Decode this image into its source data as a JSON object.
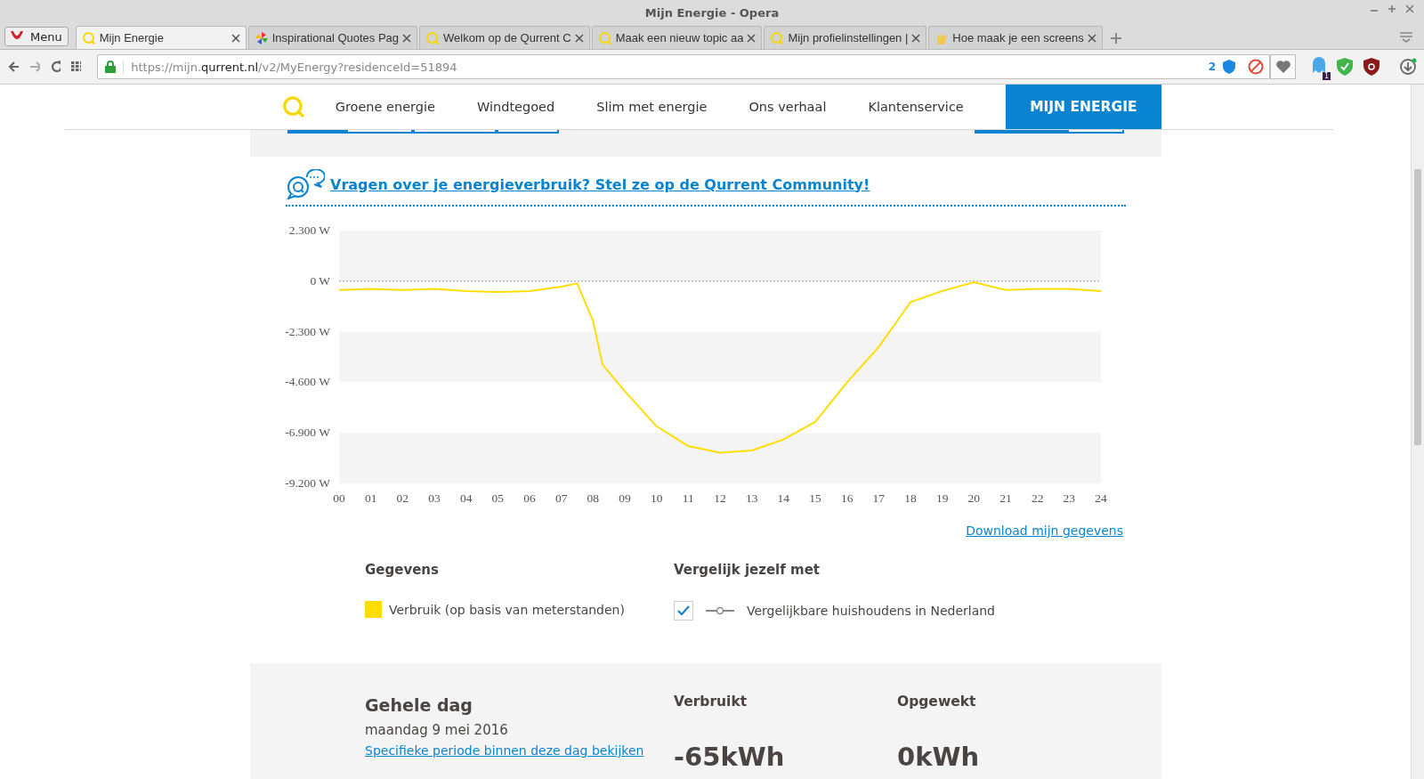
{
  "window": {
    "title": "Mijn Energie - Opera"
  },
  "browser": {
    "menu_label": "Menu",
    "tabs": [
      {
        "label": "Mijn Energie",
        "kind": "qurrent",
        "selected": true
      },
      {
        "label": "Inspirational Quotes Pag",
        "kind": "pinwheel",
        "selected": false
      },
      {
        "label": "Welkom op de Qurrent C",
        "kind": "qurrent",
        "selected": false
      },
      {
        "label": "Maak een nieuw topic aa",
        "kind": "qurrent",
        "selected": false
      },
      {
        "label": "Mijn profielinstellingen |",
        "kind": "qurrent",
        "selected": false
      },
      {
        "label": "Hoe maak je een screens",
        "kind": "hand",
        "selected": false
      }
    ],
    "url": {
      "prefix": "https://mijn.",
      "domain": "qurrent.nl",
      "path": "/v2/MyEnergy?residenceId=51894"
    },
    "shield_count": "2",
    "ghost_count": "1"
  },
  "nav": {
    "links": [
      "Groene energie",
      "Windtegoed",
      "Slim met energie",
      "Ons verhaal",
      "Klantenservice"
    ],
    "account_button": {
      "label": "MIJN ENERGIE",
      "selected": true
    }
  },
  "community_link": "Vragen over je energieverbruik? Stel ze op de Qurrent Community!",
  "chart": {
    "chart_data": {
      "type": "line",
      "x": [
        0,
        1,
        2,
        3,
        4,
        5,
        6,
        7,
        7.5,
        8,
        8.3,
        9,
        10,
        11,
        12,
        13,
        14,
        15,
        16,
        17,
        18,
        19,
        20,
        21,
        22,
        23,
        24
      ],
      "series": [
        {
          "color": "#ffdd00",
          "values": [
            -400,
            -350,
            -400,
            -350,
            -450,
            -500,
            -450,
            -250,
            -100,
            -1800,
            -3800,
            -5000,
            -6600,
            -7500,
            -7800,
            -7700,
            -7200,
            -6400,
            -4600,
            -3000,
            -950,
            -450,
            -50,
            -400,
            -350,
            -350,
            -450
          ]
        }
      ],
      "xlim": [
        0,
        24
      ],
      "ylim": [
        -9200,
        2300
      ],
      "xticks": [
        {
          "value": 0,
          "label": "00"
        },
        {
          "value": 1,
          "label": "01"
        },
        {
          "value": 2,
          "label": "02"
        },
        {
          "value": 3,
          "label": "03"
        },
        {
          "value": 4,
          "label": "04"
        },
        {
          "value": 5,
          "label": "05"
        },
        {
          "value": 6,
          "label": "06"
        },
        {
          "value": 7,
          "label": "07"
        },
        {
          "value": 8,
          "label": "08"
        },
        {
          "value": 9,
          "label": "09"
        },
        {
          "value": 10,
          "label": "10"
        },
        {
          "value": 11,
          "label": "11"
        },
        {
          "value": 12,
          "label": "12"
        },
        {
          "value": 13,
          "label": "13"
        },
        {
          "value": 14,
          "label": "14"
        },
        {
          "value": 15,
          "label": "15"
        },
        {
          "value": 16,
          "label": "16"
        },
        {
          "value": 17,
          "label": "17"
        },
        {
          "value": 18,
          "label": "18"
        },
        {
          "value": 19,
          "label": "19"
        },
        {
          "value": 20,
          "label": "20"
        },
        {
          "value": 21,
          "label": "21"
        },
        {
          "value": 22,
          "label": "22"
        },
        {
          "value": 23,
          "label": "23"
        },
        {
          "value": 24,
          "label": "24"
        }
      ],
      "yticks": [
        {
          "value": 2300,
          "label": "2.300 W"
        },
        {
          "value": 0,
          "label": "0 W"
        },
        {
          "value": -2300,
          "label": "-2.300 W"
        },
        {
          "value": -4600,
          "label": "-4.600 W"
        },
        {
          "value": -6900,
          "label": "-6.900 W"
        },
        {
          "value": -9200,
          "label": "-9.200 W"
        }
      ]
    }
  },
  "download_link": "Download mijn gegevens",
  "legend": {
    "data_title": "Gegevens",
    "series": [
      {
        "label": "Verbruik (op basis van meterstanden)",
        "color": "#ffdd00"
      }
    ],
    "compare_title": "Vergelijk jezelf met",
    "compare": [
      {
        "label": "Vergelijkbare huishoudens in Nederland",
        "checked": true
      }
    ]
  },
  "summary": {
    "title": "Gehele dag",
    "date": "maandag 9 mei 2016",
    "period_link": "Specifieke periode binnen deze dag bekijken",
    "stats": [
      {
        "label": "Verbruikt",
        "value": "-65kWh"
      },
      {
        "label": "Opgewekt",
        "value": "0kWh"
      }
    ]
  }
}
